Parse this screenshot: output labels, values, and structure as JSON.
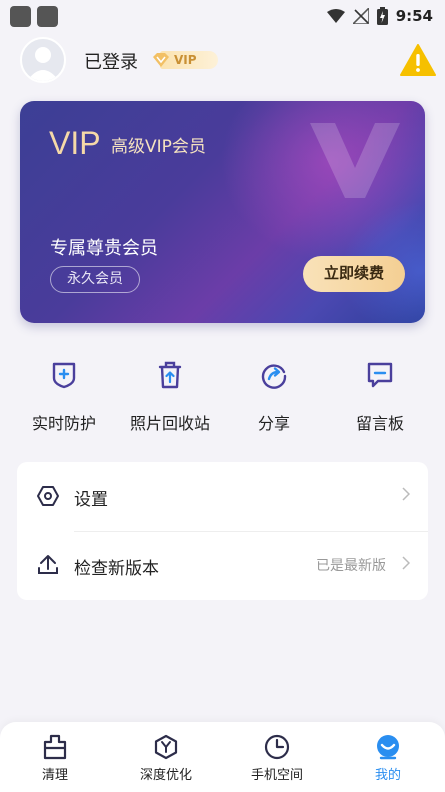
{
  "status_bar": {
    "time": "9:54"
  },
  "header": {
    "login_status": "已登录",
    "vip_badge": "VIP"
  },
  "vip_card": {
    "big_label": "VIP",
    "title": "高级VIP会员",
    "exclusive_label": "专属尊贵会员",
    "membership_type": "永久会员",
    "renew_button": "立即续费"
  },
  "actions": [
    {
      "label": "实时防护",
      "icon": "shield-plus-icon"
    },
    {
      "label": "照片回收站",
      "icon": "trash-bin-icon"
    },
    {
      "label": "分享",
      "icon": "share-icon"
    },
    {
      "label": "留言板",
      "icon": "message-board-icon"
    }
  ],
  "settings_list": [
    {
      "label": "设置",
      "icon": "settings-hex-icon",
      "hint": ""
    },
    {
      "label": "检查新版本",
      "icon": "update-icon",
      "hint": "已是最新版"
    }
  ],
  "bottom_nav": [
    {
      "label": "清理",
      "icon": "clean-icon",
      "active": false
    },
    {
      "label": "深度优化",
      "icon": "optimize-icon",
      "active": false
    },
    {
      "label": "手机空间",
      "icon": "storage-clock-icon",
      "active": false
    },
    {
      "label": "我的",
      "icon": "profile-icon",
      "active": true
    }
  ],
  "colors": {
    "accent": "#2a8ef0",
    "vip_gold": "#f5d9a8",
    "warning": "#f6c000"
  }
}
